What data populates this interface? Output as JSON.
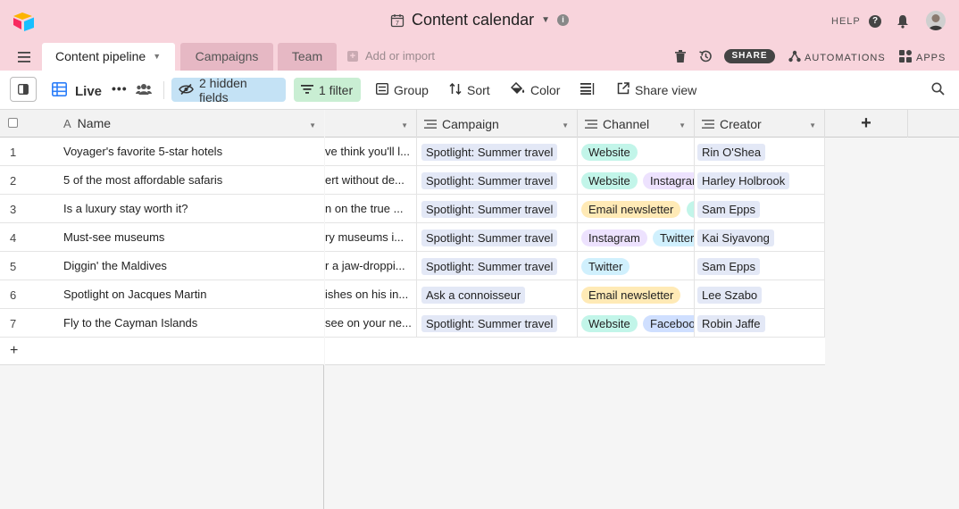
{
  "header": {
    "base_title": "Content calendar",
    "help_label": "HELP",
    "icons": [
      "airtable-logo-icon",
      "calendar-icon",
      "info-icon",
      "help-icon",
      "bell-icon",
      "avatar"
    ]
  },
  "tabs": {
    "items": [
      {
        "label": "Content pipeline",
        "active": true
      },
      {
        "label": "Campaigns",
        "active": false
      },
      {
        "label": "Team",
        "active": false
      }
    ],
    "add_import_label": "Add or import",
    "share_label": "SHARE",
    "automations_label": "AUTOMATIONS",
    "apps_label": "APPS"
  },
  "viewbar": {
    "view_name": "Live",
    "hidden_fields_label": "2 hidden fields",
    "filter_label": "1 filter",
    "group_label": "Group",
    "sort_label": "Sort",
    "color_label": "Color",
    "share_view_label": "Share view"
  },
  "grid": {
    "columns": [
      "Name",
      "Campaign",
      "Channel",
      "Creator"
    ],
    "rows": [
      {
        "num": "1",
        "name": "Voyager's favorite 5-star hotels",
        "desc": "ve think you'll l...",
        "campaign": "Spotlight: Summer travel",
        "channels": [
          "Website"
        ],
        "creator": "Rin O'Shea"
      },
      {
        "num": "2",
        "name": "5 of the most affordable safaris",
        "desc": "ert without de...",
        "campaign": "Spotlight: Summer travel",
        "channels": [
          "Website",
          "Instagram"
        ],
        "creator": "Harley Holbrook"
      },
      {
        "num": "3",
        "name": "Is a luxury stay worth it?",
        "desc": "n on the true ...",
        "campaign": "Spotlight: Summer travel",
        "channels": [
          "Email newsletter",
          "Website"
        ],
        "creator": "Sam Epps"
      },
      {
        "num": "4",
        "name": "Must-see museums",
        "desc": "ry museums i...",
        "campaign": "Spotlight: Summer travel",
        "channels": [
          "Instagram",
          "Twitter"
        ],
        "creator": "Kai Siyavong"
      },
      {
        "num": "5",
        "name": "Diggin' the Maldives",
        "desc": "r a jaw-droppi...",
        "campaign": "Spotlight: Summer travel",
        "channels": [
          "Twitter"
        ],
        "creator": "Sam Epps"
      },
      {
        "num": "6",
        "name": "Spotlight on Jacques Martin",
        "desc": "ishes on his in...",
        "campaign": "Ask a connoisseur",
        "channels": [
          "Email newsletter"
        ],
        "creator": "Lee Szabo"
      },
      {
        "num": "7",
        "name": "Fly to the Cayman Islands",
        "desc": "see on your ne...",
        "campaign": "Spotlight: Summer travel",
        "channels": [
          "Website",
          "Facebook"
        ],
        "creator": "Robin Jaffe"
      }
    ],
    "add_row_label": "+",
    "add_field_label": "+"
  },
  "colors": {
    "header_bg": "#f8d4dc",
    "hidden_fields_bg": "#c4e2f5",
    "filter_bg": "#c9eed3",
    "chip_website": "#c2f5e9",
    "chip_instagram": "#ede2fe",
    "chip_email": "#ffeab6",
    "chip_twitter": "#d0f0fd",
    "chip_facebook": "#cfdfff",
    "campaign_chip": "#e3e8f6"
  }
}
